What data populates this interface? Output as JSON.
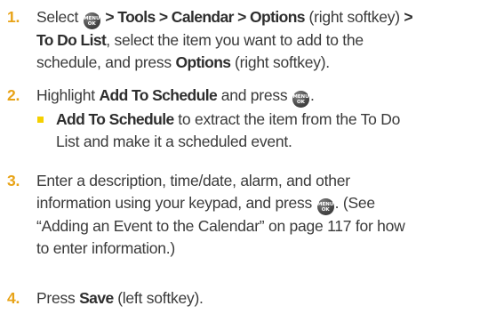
{
  "steps": [
    {
      "number": "1.",
      "line1_pre": "Select",
      "line1_path": "> Tools > Calendar > Options",
      "line1_post": "(right softkey)",
      "line1_gt": ">",
      "line2_bold": "To Do List",
      "line2_rest": ", select the item you want to add to the",
      "line3": "schedule, and press",
      "line3_bold": "Options",
      "line3_post": "(right softkey)."
    },
    {
      "number": "2.",
      "line1_pre": "Highlight",
      "line1_bold": "Add To Schedule",
      "line1_post": "and press",
      "line1_end": ".",
      "bullet_bold": "Add To Schedule",
      "bullet_rest": "to extract the item from the To Do",
      "bullet_line2": "List and make it a scheduled event."
    },
    {
      "number": "3.",
      "line1": "Enter a description, time/date, alarm, and other",
      "line2_pre": "information using your keypad, and press",
      "line2_post": ". (See",
      "line3": "“Adding an Event to the Calendar” on page 117 for how",
      "line4": "to enter information.)"
    },
    {
      "number": "4.",
      "line1_pre": "Press",
      "line1_bold": "Save",
      "line1_post": "(left softkey)."
    }
  ],
  "menu_key": {
    "top": "MENU",
    "bottom": "OK",
    "icon": "menu-ok-key-icon"
  },
  "colors": {
    "step_number": "#e8a317",
    "bullet": "#f5d000",
    "text": "#3a3a3a"
  }
}
